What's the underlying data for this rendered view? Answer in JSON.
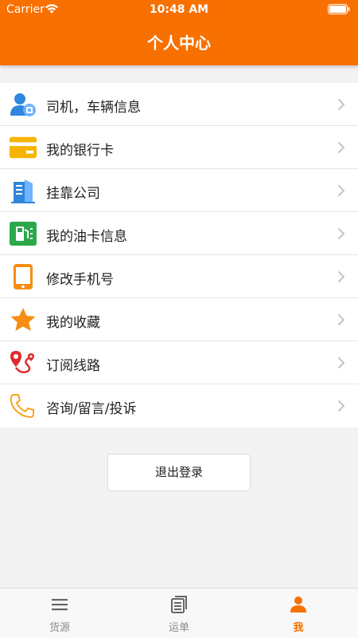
{
  "status_bar": {
    "carrier": "Carrier",
    "time": "10:48 AM"
  },
  "header": {
    "title": "个人中心"
  },
  "menu": [
    {
      "label": "司机，车辆信息",
      "icon": "driver-profile-icon"
    },
    {
      "label": "我的银行卡",
      "icon": "bank-card-icon"
    },
    {
      "label": "挂靠公司",
      "icon": "company-building-icon"
    },
    {
      "label": "我的油卡信息",
      "icon": "fuel-card-icon"
    },
    {
      "label": "修改手机号",
      "icon": "mobile-phone-icon"
    },
    {
      "label": "我的收藏",
      "icon": "star-icon"
    },
    {
      "label": "订阅线路",
      "icon": "route-icon"
    },
    {
      "label": "咨询/留言/投诉",
      "icon": "phone-icon"
    }
  ],
  "logout": {
    "label": "退出登录"
  },
  "tabbar": [
    {
      "label": "货源",
      "icon": "list-icon",
      "active": false
    },
    {
      "label": "运单",
      "icon": "orders-icon",
      "active": false
    },
    {
      "label": "我",
      "icon": "user-icon",
      "active": true
    }
  ],
  "colors": {
    "accent": "#f87000",
    "background": "#f2f2f2",
    "inactive_tab": "#8a8a8a"
  }
}
